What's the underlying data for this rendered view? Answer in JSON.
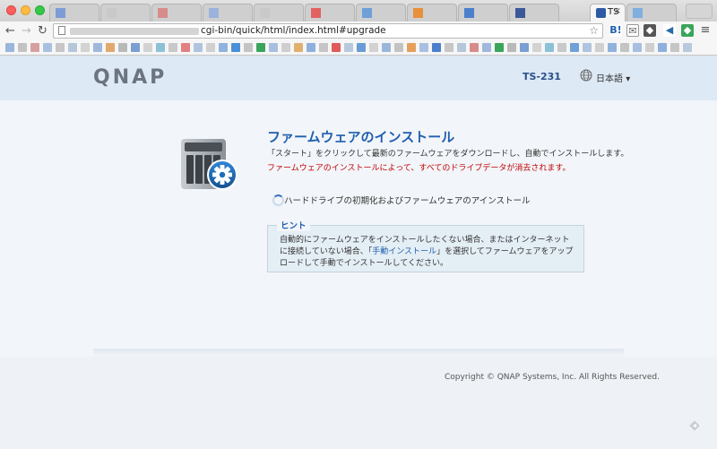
{
  "browser": {
    "active_tab_label": "TS",
    "active_tab_close": "×",
    "url": "cgi-bin/quick/html/index.html#upgrade"
  },
  "header": {
    "logo": "QNAP",
    "model": "TS-231",
    "language": "日本語",
    "language_caret": "▾"
  },
  "main": {
    "title": "ファームウェアのインストール",
    "description": "「スタート」をクリックして最新のファームウェアをダウンロードし、自動でインストールします。",
    "warning": "ファームウェアのインストールによって、すべてのドライブデータが消去されます。",
    "option": "ハードドライブの初期化およびファームウェアのアインストール"
  },
  "hint": {
    "title": "ヒント",
    "text_before": "自動的にファームウェアをインストールしたくない場合、またはインターネットに接続していない場合、「",
    "link": "手動インストール",
    "text_after": "」を選択してファームウェアをアップロードして手動でインストールしてください。"
  },
  "footer": {
    "copyright": "Copyright © QNAP Systems, Inc. All Rights Reserved."
  },
  "colors": {
    "accent": "#1f5fae",
    "warning": "#c00000",
    "header_bg": "#dde9f5"
  }
}
